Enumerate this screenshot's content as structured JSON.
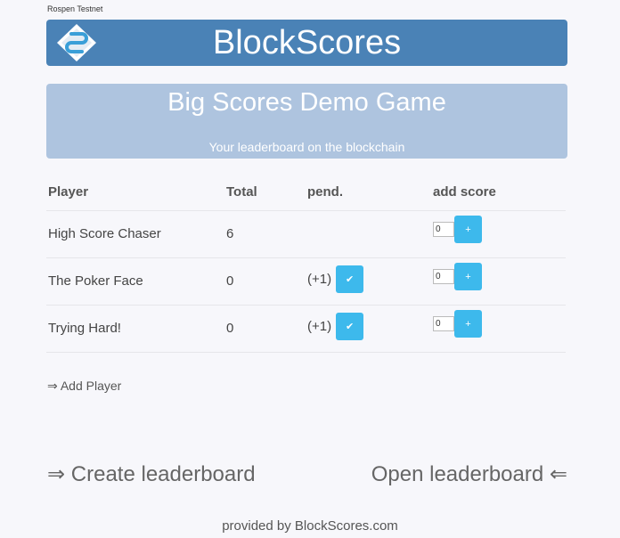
{
  "network": "Rospen Testnet",
  "header": {
    "title": "BlockScores",
    "logo_icon": "blockscores-logo-icon"
  },
  "game": {
    "title": "Big Scores Demo Game",
    "subtitle": "Your leaderboard on the blockchain"
  },
  "table": {
    "headers": [
      "Player",
      "Total",
      "pend.",
      "add score"
    ],
    "rows": [
      {
        "player": "High Score Chaser",
        "total": "6",
        "pending": "",
        "input": "0"
      },
      {
        "player": "The Poker Face",
        "total": "0",
        "pending": "(+1)",
        "input": "0"
      },
      {
        "player": "Trying Hard!",
        "total": "0",
        "pending": "(+1)",
        "input": "0"
      }
    ],
    "confirm_glyph": "✔",
    "add_glyph": "+"
  },
  "links": {
    "add_player": "⇒ Add Player",
    "create": "⇒ Create leaderboard",
    "open": "Open leaderboard ⇐"
  },
  "footer": "provided by BlockScores.com",
  "colors": {
    "header_bg": "#4a82b6",
    "panel_bg": "#aec4df",
    "button": "#3db9ec"
  }
}
